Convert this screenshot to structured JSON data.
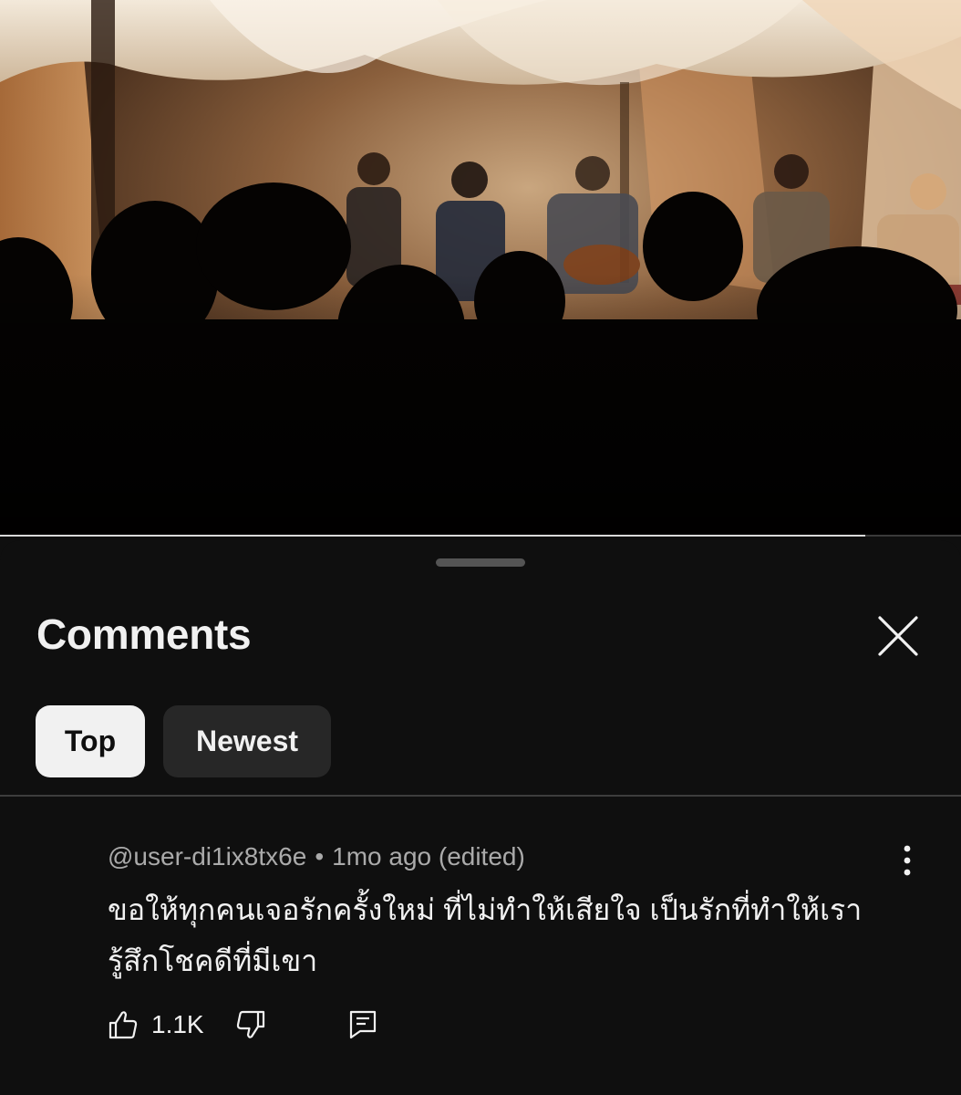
{
  "player": {
    "progress_fraction": 0.9
  },
  "comments_panel": {
    "title": "Comments",
    "close_icon": "close-icon",
    "sort_chips": [
      {
        "label": "Top",
        "selected": true
      },
      {
        "label": "Newest",
        "selected": false
      }
    ]
  },
  "comment": {
    "author": "@user-di1ix8tx6e",
    "separator": "•",
    "time": "1mo ago (edited)",
    "text_lines": [
      "ขอให้ทุกคนเจอรักครั้งใหม่ ที่ไม่ทำให้เสียใจ เป็นรักที่ทำให้เรา",
      "รู้สึกโชคดีที่มีเขา"
    ],
    "like_count": "1.1K",
    "icons": {
      "like": "thumbs-up-icon",
      "dislike": "thumbs-down-icon",
      "reply": "reply-comment-icon",
      "more": "more-vertical-icon"
    }
  },
  "colors": {
    "background": "#0f0f0f",
    "chip_active_bg": "#f1f1f1",
    "chip_inactive_bg": "#272727",
    "secondary_text": "#aaaaaa"
  }
}
